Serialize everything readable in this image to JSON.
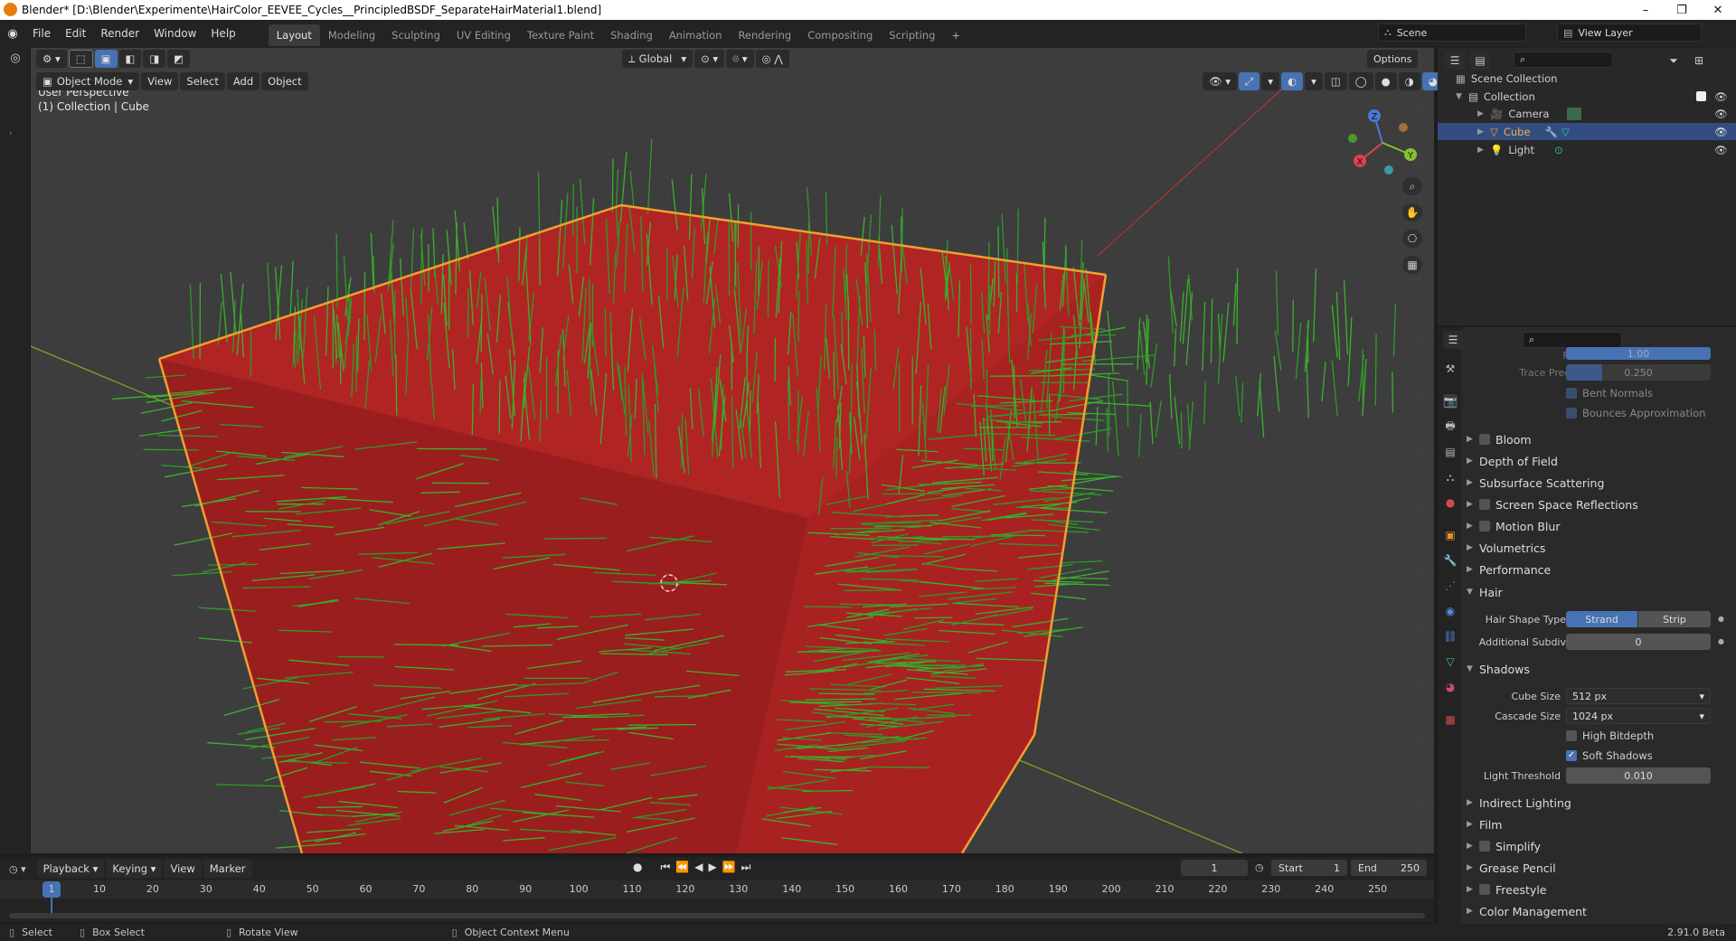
{
  "window": {
    "title": "Blender* [D:\\Blender\\Experimente\\HairColor_EEVEE_Cycles__PrincipledBSDF_SeparateHairMaterial1.blend]",
    "minimize": "–",
    "maximize": "❐",
    "close": "✕"
  },
  "menus": [
    "File",
    "Edit",
    "Render",
    "Window",
    "Help"
  ],
  "workspaces": [
    {
      "label": "Layout",
      "active": true
    },
    {
      "label": "Modeling",
      "active": false
    },
    {
      "label": "Sculpting",
      "active": false
    },
    {
      "label": "UV Editing",
      "active": false
    },
    {
      "label": "Texture Paint",
      "active": false
    },
    {
      "label": "Shading",
      "active": false
    },
    {
      "label": "Animation",
      "active": false
    },
    {
      "label": "Rendering",
      "active": false
    },
    {
      "label": "Compositing",
      "active": false
    },
    {
      "label": "Scripting",
      "active": false
    }
  ],
  "add_workspace": "+",
  "scene": {
    "label": "Scene",
    "view_layer": "View Layer"
  },
  "viewport": {
    "mode": "Object Mode",
    "menus": [
      "View",
      "Select",
      "Add",
      "Object"
    ],
    "orientation": "Global",
    "options": "Options",
    "info_line1": "User Perspective",
    "info_line2": "(1) Collection | Cube",
    "gizmo": {
      "x": "X",
      "y": "Y",
      "z": "Z"
    }
  },
  "outliner": {
    "root": "Scene Collection",
    "collection": "Collection",
    "items": [
      {
        "name": "Camera",
        "selected": false
      },
      {
        "name": "Cube",
        "selected": true
      },
      {
        "name": "Light",
        "selected": false
      }
    ]
  },
  "properties": {
    "top_fields": [
      {
        "label": "Factor",
        "value": "1.00"
      },
      {
        "label": "Trace Precision",
        "value": "0.250"
      }
    ],
    "top_checks": [
      {
        "label": "Bent Normals",
        "checked": true
      },
      {
        "label": "Bounces Approximation",
        "checked": true
      }
    ],
    "panels_a": [
      {
        "label": "Bloom",
        "checkbox": true
      },
      {
        "label": "Depth of Field",
        "checkbox": false
      },
      {
        "label": "Subsurface Scattering",
        "checkbox": false
      },
      {
        "label": "Screen Space Reflections",
        "checkbox": true
      },
      {
        "label": "Motion Blur",
        "checkbox": true
      },
      {
        "label": "Volumetrics",
        "checkbox": false
      },
      {
        "label": "Performance",
        "checkbox": false
      }
    ],
    "hair": {
      "label": "Hair",
      "shape_type_label": "Hair Shape Type",
      "strand": "Strand",
      "strip": "Strip",
      "subdiv_label": "Additional Subdiv",
      "subdiv_value": "0"
    },
    "shadows": {
      "label": "Shadows",
      "cube_size_label": "Cube Size",
      "cube_size": "512 px",
      "cascade_size_label": "Cascade Size",
      "cascade_size": "1024 px",
      "high_bitdepth": "High Bitdepth",
      "soft_shadows": "Soft Shadows",
      "light_threshold_label": "Light Threshold",
      "light_threshold": "0.010"
    },
    "panels_b": [
      {
        "label": "Indirect Lighting",
        "checkbox": false
      },
      {
        "label": "Film",
        "checkbox": false
      },
      {
        "label": "Simplify",
        "checkbox": true
      },
      {
        "label": "Grease Pencil",
        "checkbox": false
      },
      {
        "label": "Freestyle",
        "checkbox": true
      },
      {
        "label": "Color Management",
        "checkbox": false
      }
    ]
  },
  "timeline": {
    "menus": [
      "Playback",
      "Keying",
      "View",
      "Marker"
    ],
    "current_frame": "1",
    "start_label": "Start",
    "start": "1",
    "end_label": "End",
    "end": "250",
    "ticks": [
      "1",
      "10",
      "20",
      "30",
      "40",
      "50",
      "60",
      "70",
      "80",
      "90",
      "100",
      "110",
      "120",
      "130",
      "140",
      "150",
      "160",
      "170",
      "180",
      "190",
      "200",
      "210",
      "220",
      "230",
      "240",
      "250"
    ]
  },
  "status": {
    "select": "Select",
    "box_select": "Box Select",
    "rotate": "Rotate View",
    "context": "Object Context Menu",
    "version": "2.91.0 Beta"
  },
  "colors": {
    "accent": "#4772b3",
    "cube_red": "#b32424",
    "outline": "#f0a030",
    "hair_green": "#2f9a28"
  }
}
